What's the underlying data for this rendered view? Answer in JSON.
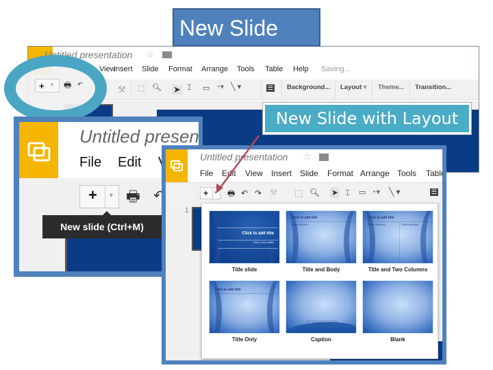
{
  "callouts": {
    "title": "New Slide",
    "layout_label": "New Slide with Layout"
  },
  "app": {
    "doc_title": "Untitled presentation",
    "status": "Saving..."
  },
  "menu": [
    "File",
    "Edit",
    "View",
    "Insert",
    "Slide",
    "Format",
    "Arrange",
    "Tools",
    "Table",
    "Help"
  ],
  "toolbar": {
    "new_slide_icon": "+",
    "background": "Background...",
    "layout": "Layout",
    "theme": "Theme...",
    "transition": "Transition..."
  },
  "tooltip": "New slide (Ctrl+M)",
  "filmstrip": {
    "slide_number": "1"
  },
  "gallery": {
    "layouts": [
      {
        "name": "Title slide",
        "title_placeholder": "Click to add title",
        "subtitle_placeholder": "Click to add subtitle"
      },
      {
        "name": "Title and Body",
        "title_placeholder": "Click to add title",
        "body_placeholder": "Click to add text"
      },
      {
        "name": "Title and Two Columns",
        "title_placeholder": "Click to add title",
        "left_placeholder": "Click to add text",
        "right_placeholder": "Click to add text"
      },
      {
        "name": "Title Only",
        "title_placeholder": "Click to add title"
      },
      {
        "name": "Caption",
        "caption_placeholder": "Click to add text"
      },
      {
        "name": "Blank"
      }
    ]
  },
  "colors": {
    "callout_blue": "#4f81bd",
    "callout_teal": "#4bacc6",
    "logo_yellow": "#f4b400",
    "slide_navy": "#0a3c85",
    "arrow": "#b04a5a"
  }
}
